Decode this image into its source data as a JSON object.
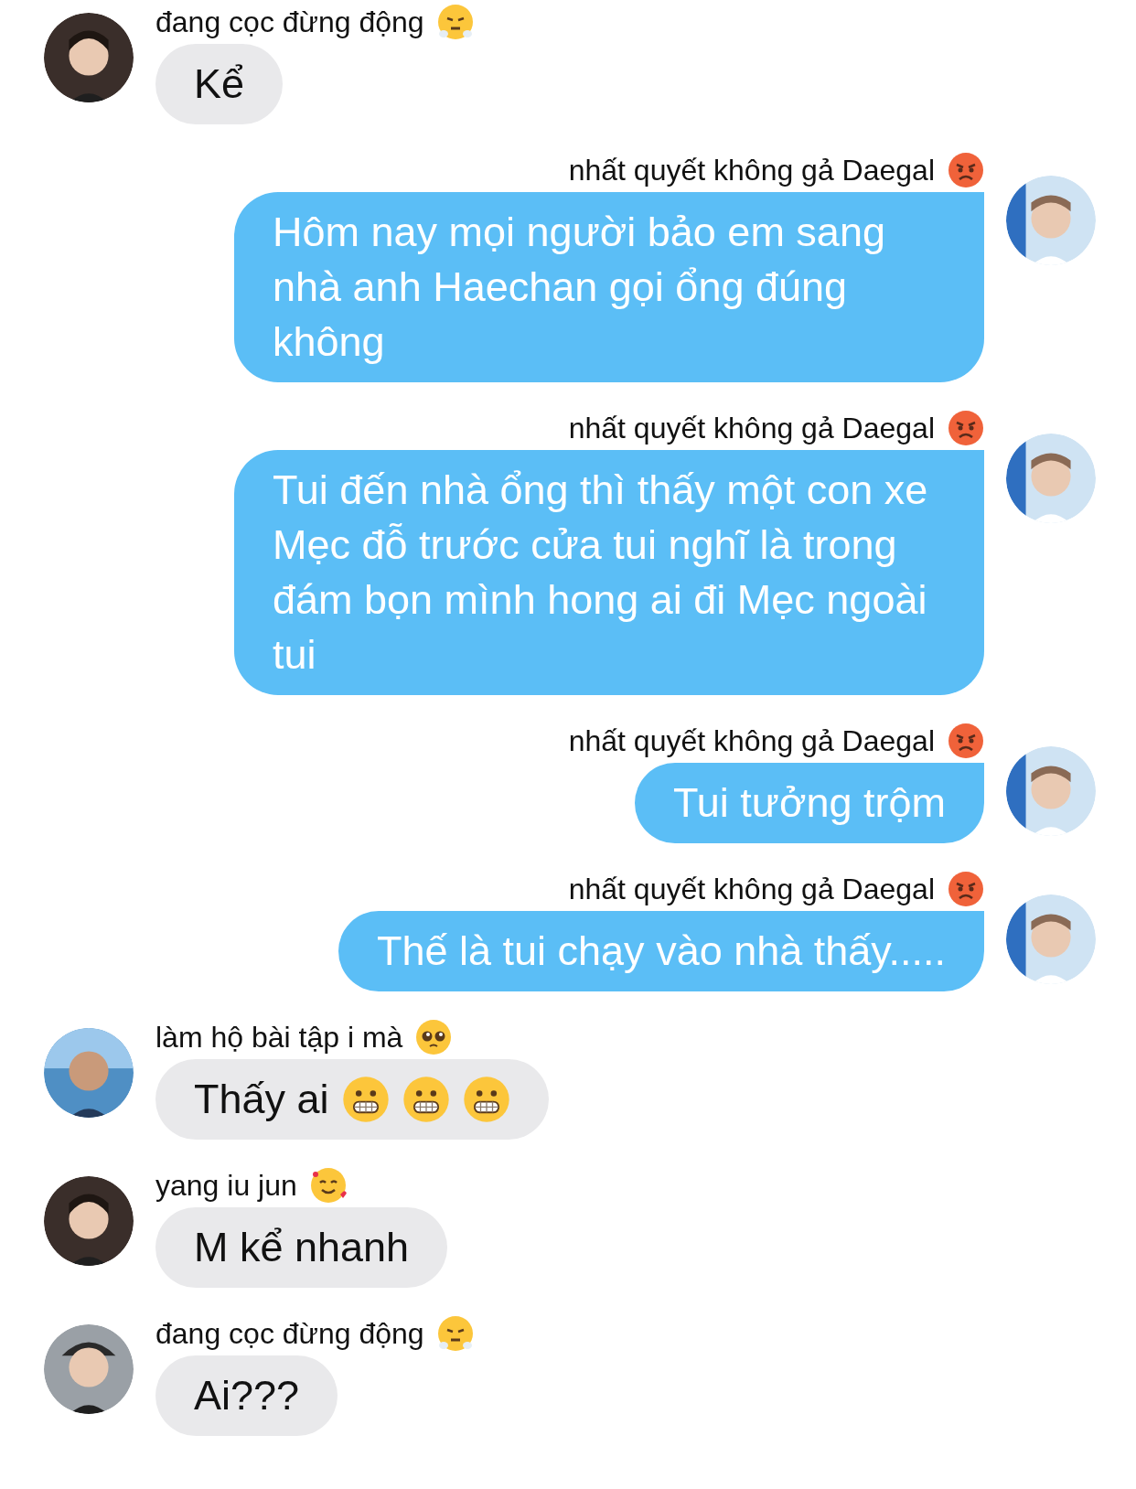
{
  "messages": [
    {
      "kind": "incoming",
      "sender": "đang cọc đừng động",
      "sender_icon": {
        "kind": "steam"
      },
      "text": "Kể"
    },
    {
      "kind": "outgoing",
      "sender": "nhất quyết không gả Daegal",
      "sender_icon": {
        "kind": "angry"
      },
      "text": "Hôm nay mọi người bảo em sang nhà anh Haechan gọi ổng đúng không"
    },
    {
      "kind": "outgoing",
      "sender": "nhất quyết không gả Daegal",
      "sender_icon": {
        "kind": "angry"
      },
      "text": "Tui đến nhà ổng thì thấy một con xe Mẹc đỗ trước cửa tui nghĩ là trong đám bọn mình hong ai đi Mẹc ngoài tui"
    },
    {
      "kind": "outgoing",
      "sender": "nhất quyết không gả Daegal",
      "sender_icon": {
        "kind": "angry"
      },
      "text": "Tui tưởng trộm"
    },
    {
      "kind": "outgoing",
      "sender": "nhất quyết không gả Daegal",
      "sender_icon": {
        "kind": "angry"
      },
      "text": "Thế là tui chạy vào nhà thấy....."
    },
    {
      "kind": "incoming",
      "sender": "làm hộ bài tập i mà",
      "sender_icon": {
        "kind": "pleading"
      },
      "text": "Thấy ai",
      "emojis": [
        {
          "kind": "grimace"
        },
        {
          "kind": "grimace"
        },
        {
          "kind": "grimace"
        }
      ]
    },
    {
      "kind": "incoming",
      "sender": "yang iu jun",
      "sender_icon": {
        "kind": "hearts"
      },
      "text": "M kể nhanh"
    },
    {
      "kind": "incoming",
      "sender": "đang cọc đừng động",
      "sender_icon": {
        "kind": "steam"
      },
      "text": "Ai???"
    }
  ]
}
